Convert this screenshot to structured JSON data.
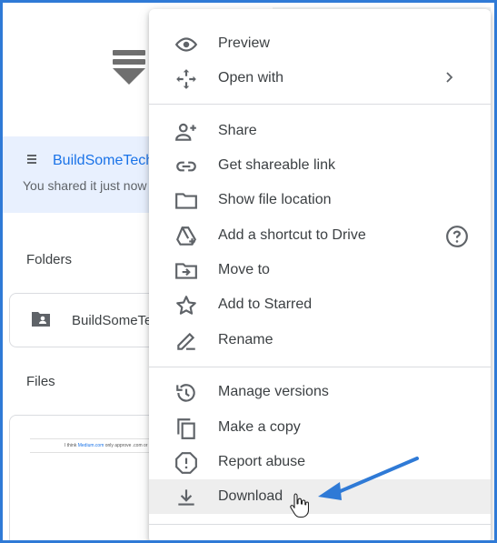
{
  "background": {
    "shared_item": {
      "title": "BuildSomeTech",
      "subtitle": "You shared it just now"
    },
    "folders_label": "Folders",
    "folder": {
      "name": "BuildSomeTech"
    },
    "files_label": "Files",
    "file_preview": {
      "text_before": "I think ",
      "link": "Medium.com",
      "text_after": " only approve .com or good t"
    }
  },
  "menu": {
    "items": [
      {
        "label": "Preview",
        "icon": "eye-icon"
      },
      {
        "label": "Open with",
        "icon": "move-arrows-icon",
        "submenu": true
      },
      {
        "label": "Share",
        "icon": "person-add-icon"
      },
      {
        "label": "Get shareable link",
        "icon": "link-icon"
      },
      {
        "label": "Show file location",
        "icon": "folder-icon"
      },
      {
        "label": "Add a shortcut to Drive",
        "icon": "drive-shortcut-icon",
        "help": true
      },
      {
        "label": "Move to",
        "icon": "move-to-folder-icon"
      },
      {
        "label": "Add to Starred",
        "icon": "star-icon"
      },
      {
        "label": "Rename",
        "icon": "pencil-icon"
      },
      {
        "label": "Manage versions",
        "icon": "history-icon"
      },
      {
        "label": "Make a copy",
        "icon": "copy-icon"
      },
      {
        "label": "Report abuse",
        "icon": "report-icon"
      },
      {
        "label": "Download",
        "icon": "download-icon",
        "hovered": true
      }
    ]
  },
  "colors": {
    "accent": "#1a73e8",
    "frame": "#2f7ad6",
    "icon": "#5f6368",
    "hover": "#eeeeee",
    "banner": "#e8f0fe"
  }
}
